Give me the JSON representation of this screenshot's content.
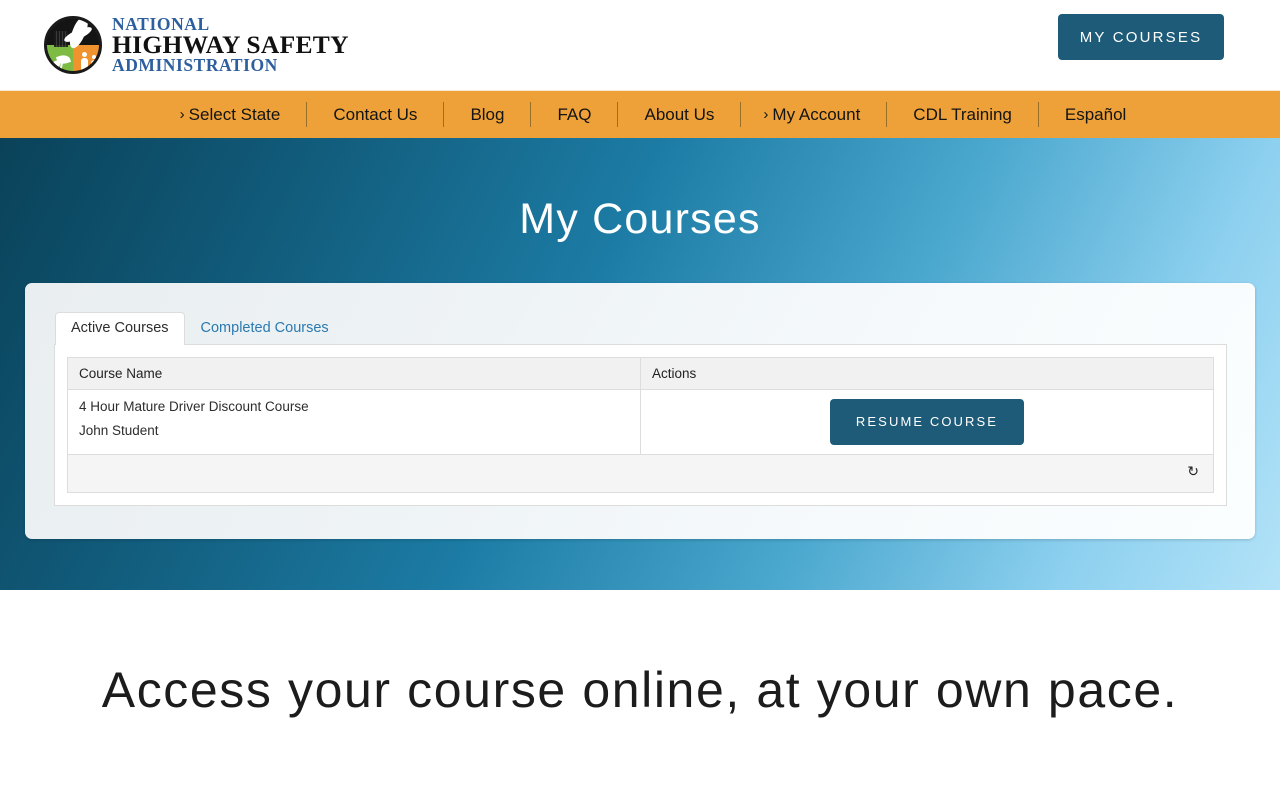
{
  "header": {
    "logo": {
      "line1": "NATIONAL",
      "line2": "HIGHWAY SAFETY",
      "line3": "ADMINISTRATION",
      "mark_name": "nhsa-circular-emblem",
      "line1_color": "#2d5e9e",
      "line2_color": "#111111",
      "line3_color": "#2d5e9e"
    },
    "my_courses_button": "MY COURSES",
    "button_color": "#1d5b78"
  },
  "nav": {
    "background_color": "#eda138",
    "items": [
      {
        "label": "Select State",
        "chevron": "›"
      },
      {
        "label": "Contact Us",
        "chevron": ""
      },
      {
        "label": "Blog",
        "chevron": ""
      },
      {
        "label": "FAQ",
        "chevron": ""
      },
      {
        "label": "About Us",
        "chevron": ""
      },
      {
        "label": "My Account",
        "chevron": "›"
      },
      {
        "label": "CDL Training",
        "chevron": ""
      },
      {
        "label": "Español",
        "chevron": ""
      }
    ]
  },
  "hero": {
    "title": "My Courses",
    "gradient_start": "#0a4259",
    "gradient_end": "#b3e3f8"
  },
  "card": {
    "tabs": [
      {
        "label": "Active Courses",
        "active": true
      },
      {
        "label": "Completed Courses",
        "active": false
      }
    ],
    "table": {
      "headers": [
        "Course Name",
        "Actions"
      ],
      "rows": [
        {
          "course_title": "4 Hour Mature Driver Discount Course",
          "student_name": "John Student",
          "action_label": "RESUME COURSE"
        }
      ],
      "footer_icon": "↻",
      "footer_icon_name": "refresh-icon"
    }
  },
  "promo": {
    "heading": "Access your course online, at your own pace."
  }
}
